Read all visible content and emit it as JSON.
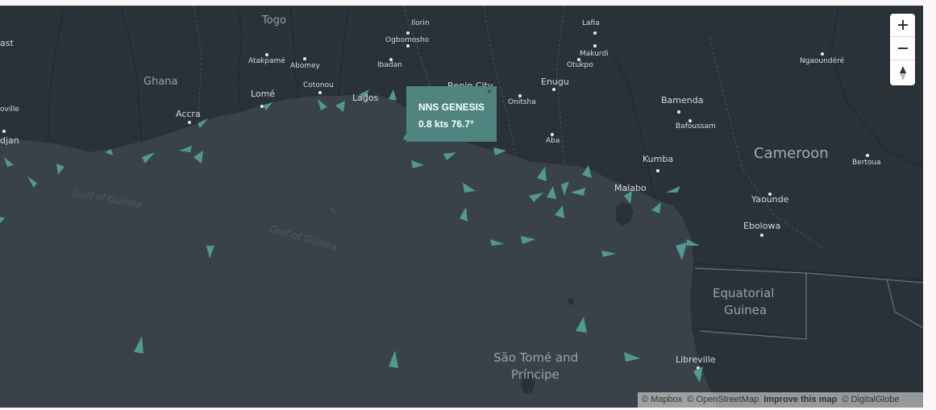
{
  "map": {
    "countries": [
      {
        "name": "Togo",
        "kind": "country"
      },
      {
        "name": "Ghana",
        "kind": "country"
      },
      {
        "name": "Cameroon",
        "kind": "country-big"
      },
      {
        "name": "Equatorial",
        "kind": "country-mid"
      },
      {
        "name": "Guinea",
        "kind": "country-mid"
      }
    ],
    "cities": [
      {
        "name": "Ilorin",
        "dot": true
      },
      {
        "name": "Lafia",
        "dot": true
      },
      {
        "name": "Ogbomosho",
        "dot": true
      },
      {
        "name": "Makurdi",
        "dot": true
      },
      {
        "name": "Atakpamé",
        "dot": true
      },
      {
        "name": "Abomey",
        "dot": true
      },
      {
        "name": "Ibadan",
        "dot": true
      },
      {
        "name": "Otukpo",
        "dot": true
      },
      {
        "name": "Ngaoundéré",
        "dot": true
      },
      {
        "name": "Enugu",
        "dot": true
      },
      {
        "name": "Benin City",
        "dot": true
      },
      {
        "name": "Cotonou",
        "dot": true
      },
      {
        "name": "Lomé",
        "dot": true
      },
      {
        "name": "Lagos",
        "dot": true
      },
      {
        "name": "Accra",
        "dot": true
      },
      {
        "name": "Onitsha",
        "dot": true
      },
      {
        "name": "Bamenda",
        "dot": true
      },
      {
        "name": "Bafoussam",
        "dot": true
      },
      {
        "name": "Aba",
        "dot": true
      },
      {
        "name": "Kumba",
        "dot": true
      },
      {
        "name": "Bertoua",
        "dot": true
      },
      {
        "name": "Malabo",
        "dot": true
      },
      {
        "name": "Yaounde",
        "dot": true
      },
      {
        "name": "Ebolowa",
        "dot": true
      },
      {
        "name": "Libreville",
        "dot": true
      },
      {
        "name": "ast",
        "dot": false
      },
      {
        "name": "oville",
        "dot": false
      },
      {
        "name": "djan",
        "dot": true
      }
    ],
    "water_labels": [
      "Gulf of Guinea",
      "Gulf of Guinea"
    ],
    "islands": [
      "São Tomé and",
      "Príncipe"
    ],
    "colors": {
      "water": "#3a4249",
      "land": "#2b3237",
      "vessel": "#4f9a93",
      "popup": "#4f8480"
    },
    "vessel_icon": "vessel-triangle-icon"
  },
  "popup": {
    "vessel_name": "NNS GENESIS",
    "details": "0.8 kts 76.7°",
    "close_label": "×"
  },
  "controls": {
    "zoom_in_icon": "plus-icon",
    "zoom_out_icon": "minus-icon",
    "compass_icon": "compass-icon"
  },
  "attribution": {
    "mapbox": "© Mapbox",
    "osm": "© OpenStreetMap",
    "improve": "Improve this map",
    "digitalglobe": "© DigitalGlobe"
  }
}
